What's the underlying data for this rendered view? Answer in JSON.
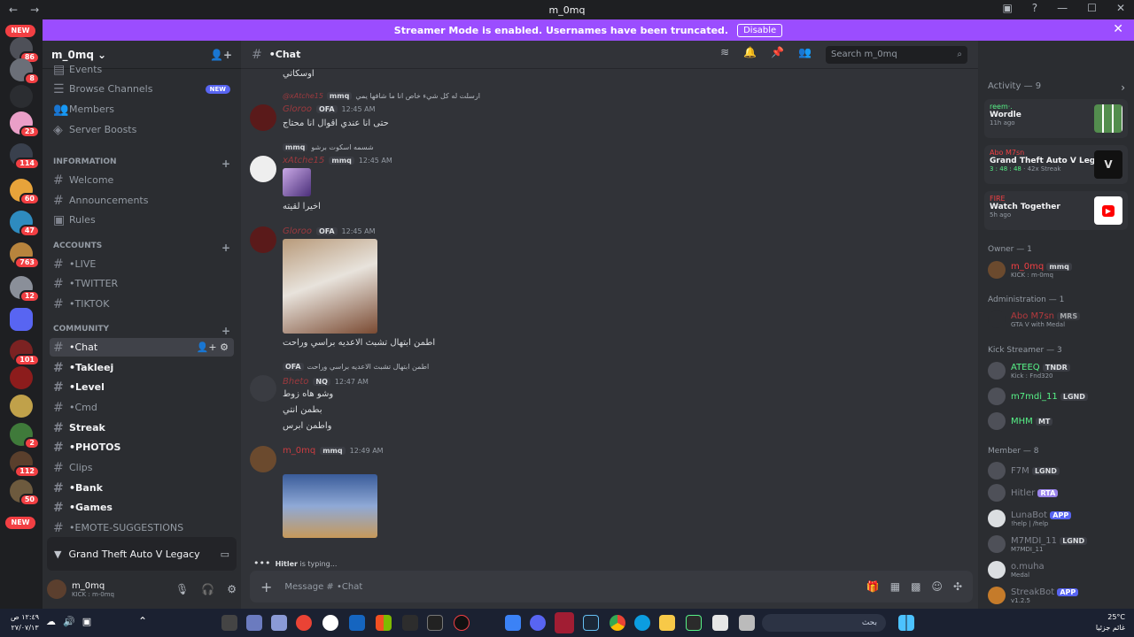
{
  "window": {
    "title": "m_0mq"
  },
  "banner": {
    "text": "Streamer Mode is enabled. Usernames have been truncated.",
    "button": "Disable"
  },
  "guilds": {
    "new_top": "NEW",
    "new_bottom": "NEW",
    "badges": [
      "86",
      "8",
      "23",
      "114",
      "60",
      "47",
      "763",
      "12",
      "101",
      "2",
      "112",
      "50"
    ]
  },
  "server": {
    "name": "m_0mq"
  },
  "channels": {
    "top_items": [
      {
        "label": "Events"
      },
      {
        "label": "Browse Channels",
        "tag": "NEW"
      },
      {
        "label": "Members"
      },
      {
        "label": "Server Boosts"
      }
    ],
    "categories": [
      {
        "label": "INFORMATION"
      },
      {
        "label": "ACCOUNTS"
      },
      {
        "label": "COMMUNITY"
      }
    ],
    "info": [
      "Welcome",
      "Announcements",
      "Rules"
    ],
    "accounts": [
      "•LIVE",
      "•TWITTER",
      "•TIKTOK"
    ],
    "community": [
      "•Chat",
      "•Takleej",
      "•Level",
      "•Cmd",
      "Streak",
      "•PHOTOS",
      "Clips",
      "•Bank",
      "•Games",
      "•EMOTE-SUGGESTIONS"
    ]
  },
  "activity": {
    "game": "Grand Theft Auto V Legacy"
  },
  "user": {
    "name": "m_0mq",
    "status": "KICK : m-0mq"
  },
  "chat": {
    "channel": "•Chat",
    "search_placeholder": "Search m_0mq",
    "messages": [
      {
        "text": "اوسكاتي"
      },
      {
        "reply": "ارسلت له كل شيء خاص انا ما شافها يمي",
        "reply_user": "@xAtche15",
        "reply_tag": "mmq",
        "user": "Gloroo",
        "tag": "OFA",
        "time": "12:45 AM",
        "text": "حتى انا عندي اقوال انا محتاج"
      },
      {
        "reply": "شسمه اسكوت برشو",
        "reply_tag": "mmq",
        "user": "xAtche15",
        "tag": "mmq",
        "time": "12:45 AM",
        "text": "اخيرا لقيته"
      },
      {
        "user": "Gloroo",
        "tag": "OFA",
        "time": "12:45 AM",
        "text": "اطمن ابتهال تشبث الاعديه براسي وراحت"
      },
      {
        "reply": "اطمن ابتهال تشبث الاعديه براسي وراحت",
        "reply_tag": "OFA",
        "user": "Bheto",
        "tag": "NQ",
        "time": "12:47 AM",
        "lines": [
          "وشو هاه زوط",
          "بطمن انتي",
          "واطمن ابرس"
        ]
      },
      {
        "user": "m_0mq",
        "tag": "mmq",
        "time": "12:49 AM"
      }
    ],
    "typing_user": "Hitler",
    "typing_suffix": "is typing...",
    "composer_placeholder": "Message # •Chat"
  },
  "members": {
    "activity_header": "Activity — 9",
    "cards": [
      {
        "user": "reem·.",
        "game": "Wordle",
        "time": "11h ago"
      },
      {
        "user": "Abo M7sn",
        "game": "Grand Theft Auto V Legacy",
        "time": "3 : 48 : 48",
        "streak": "42x Streak"
      },
      {
        "user": "FIRE",
        "game": "Watch Together",
        "time": "5h ago"
      }
    ],
    "groups": [
      {
        "header": "Owner — 1",
        "rows": [
          {
            "name": "m_0mq",
            "tag": "mmq",
            "sub": "KICK : m-0mq"
          }
        ]
      },
      {
        "header": "Administration — 1",
        "rows": [
          {
            "name": "Abo M7sn",
            "tag": "MRS",
            "sub": "GTA V with Medal"
          }
        ]
      },
      {
        "header": "Kick Streamer — 3",
        "rows": [
          {
            "name": "ATEEQ",
            "tag": "TNDR",
            "sub": "Kick : Fnd320"
          },
          {
            "name": "m7mdi_11",
            "tag": "LGND",
            "sub": ""
          },
          {
            "name": "MHM",
            "tag": "MT",
            "sub": ""
          }
        ]
      },
      {
        "header": "Member — 8",
        "rows": [
          {
            "name": "F7M",
            "tag": "LGND",
            "sub": ""
          },
          {
            "name": "Hitler",
            "tag": "RTA",
            "sub": ""
          },
          {
            "name": "LunaBot",
            "tag": "APP",
            "sub": "!help | /help"
          },
          {
            "name": "M7MDI_11",
            "tag": "LGND",
            "sub": "M7MDI_11"
          },
          {
            "name": "o.muha",
            "tag": "",
            "sub": "Medal"
          },
          {
            "name": "StreakBot",
            "tag": "APP",
            "sub": "v1.2.5"
          }
        ]
      }
    ]
  },
  "taskbar": {
    "clock_time": "١٢:٤٩ ص",
    "clock_date": "٢٧/٠٧/١٣",
    "search_text": "بحث",
    "temp": "25°C",
    "weather": "غائم جزئيا"
  },
  "colors": {
    "accent": "#9b4dff",
    "danger": "#f23f43",
    "app": "#5865f2"
  }
}
